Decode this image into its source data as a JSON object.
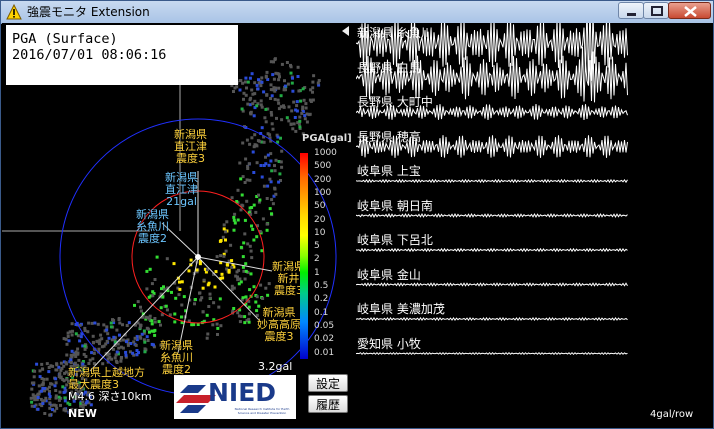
{
  "window": {
    "title": "強震モニタ Extension"
  },
  "info": {
    "line1": "PGA (Surface)",
    "line2": "2016/07/01 08:06:16"
  },
  "scale": {
    "title": "PGA[gal]",
    "ticks": [
      "1000",
      "500",
      "200",
      "100",
      "50",
      "20",
      "10",
      "5",
      "2",
      "1",
      "0.5",
      "0.2",
      "0.1",
      "0.05",
      "0.02",
      "0.01"
    ]
  },
  "labels": {
    "naoetsu": [
      "新潟県",
      "直江津",
      "震度3"
    ],
    "naoetsu2": [
      "新潟県",
      "直江津",
      "21gal"
    ],
    "itoigawa1": [
      "新潟県",
      "糸魚川",
      "震度2"
    ],
    "arai": [
      "新潟県",
      "新井",
      "震度3"
    ],
    "myoko": [
      "新潟県",
      "妙高高原",
      "震度3"
    ],
    "itoigawa2": [
      "新潟県",
      "糸魚川",
      "震度2"
    ],
    "epicenter": [
      "新潟県上越地方",
      "最大震度3"
    ],
    "magnitude": "M4.6 深さ10km",
    "gal_value": "3.2gal",
    "new": "NEW",
    "nied": "NIED",
    "nied_sub": "National Research Institute for Earth Science and Disaster Prevention"
  },
  "buttons": {
    "settings": "設定",
    "history": "履歴"
  },
  "waves": [
    "新潟県 糸魚川",
    "長野県 白馬",
    "長野県 大町中",
    "長野県 穂高",
    "岐阜県 上宝",
    "岐阜県 朝日南",
    "岐阜県 下呂北",
    "岐阜県 金山",
    "岐阜県 美濃加茂",
    "愛知県 小牧"
  ],
  "footer": {
    "scale_note": "4gal/row"
  },
  "colors": {
    "epicenter_circle": "#ff2020",
    "wave_circle": "#2030ff",
    "label_intensity": "#ffd23c",
    "label_gal": "#6cc6ff"
  }
}
